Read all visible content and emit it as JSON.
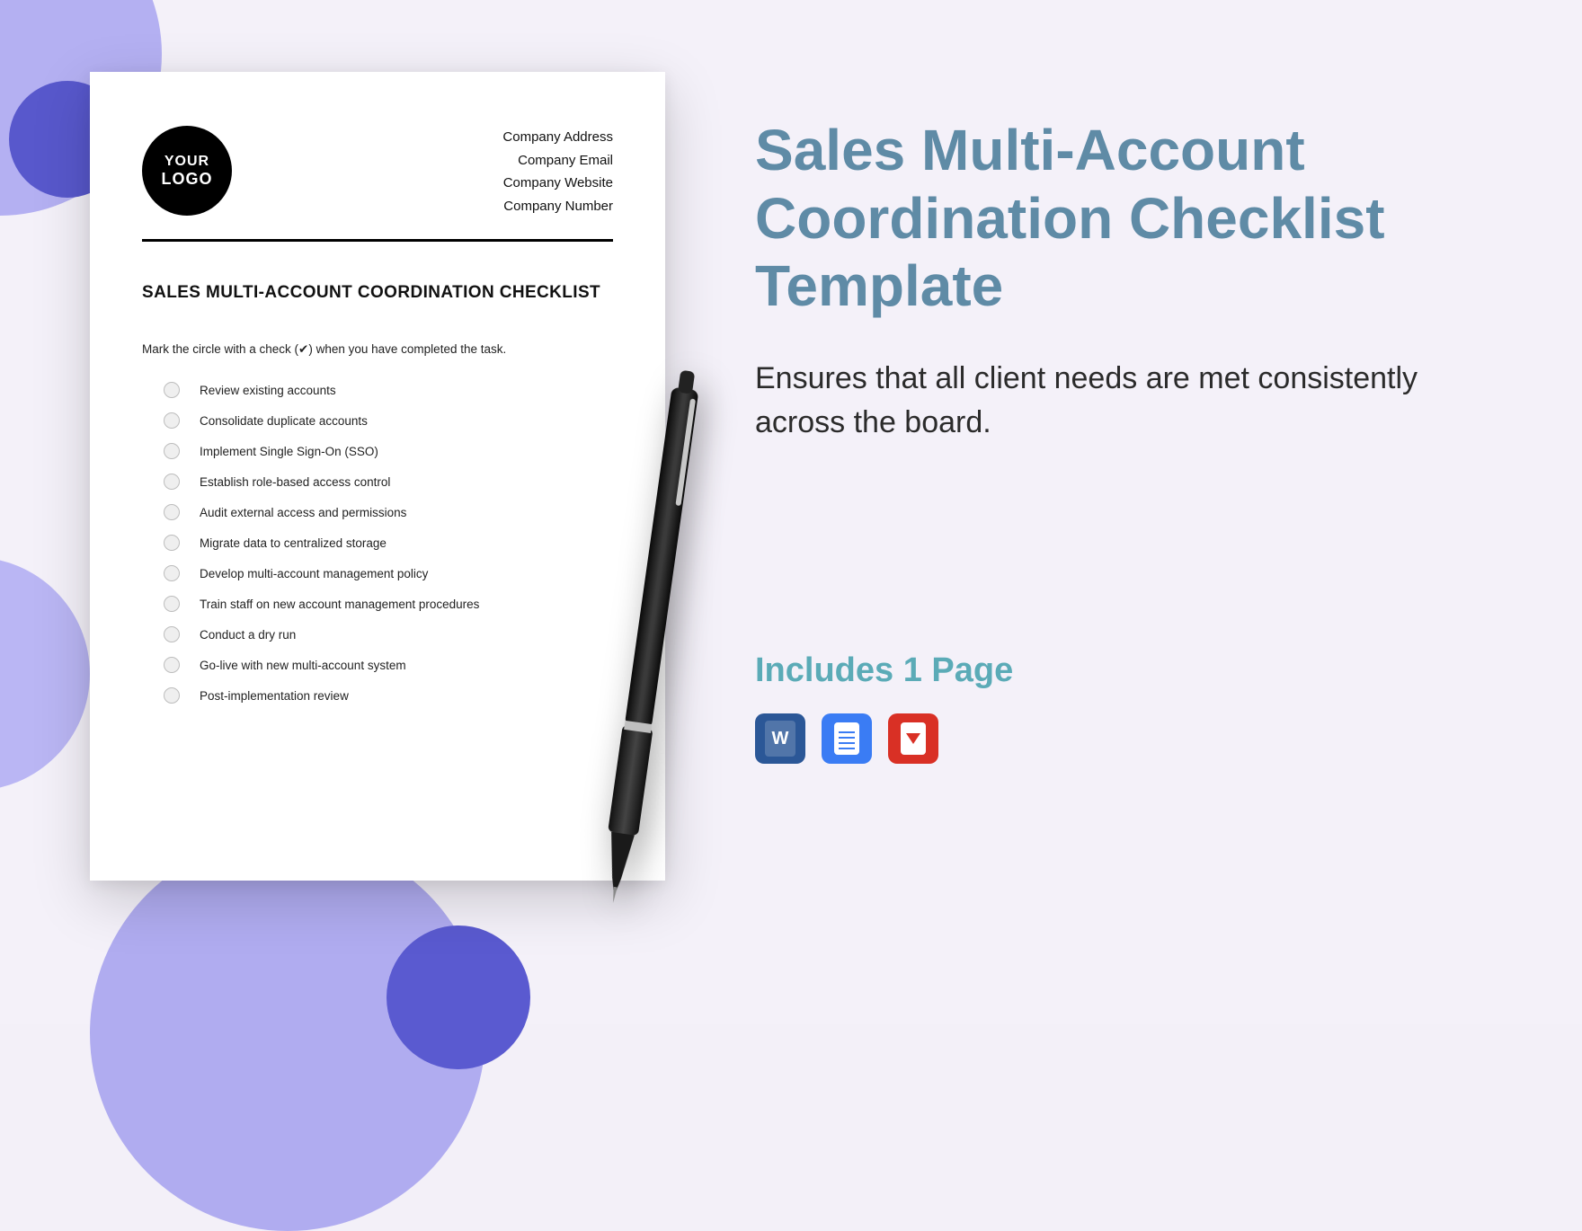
{
  "document": {
    "logo": {
      "line1": "YOUR",
      "line2": "LOGO"
    },
    "company_info": [
      "Company Address",
      "Company Email",
      "Company Website",
      "Company Number"
    ],
    "title": "SALES MULTI-ACCOUNT COORDINATION CHECKLIST",
    "instruction": "Mark the circle with a check (✔) when you have completed the task.",
    "checklist": [
      "Review existing accounts",
      "Consolidate duplicate accounts",
      "Implement Single Sign-On (SSO)",
      "Establish role-based access control",
      "Audit external access and permissions",
      "Migrate data to centralized storage",
      "Develop multi-account management policy",
      "Train staff on new account management procedures",
      "Conduct a dry run",
      "Go-live with new multi-account system",
      "Post-implementation review"
    ]
  },
  "promo": {
    "title": "Sales Multi-Account Coordination Checklist Template",
    "description": "Ensures that all client needs are met consistently across the board.",
    "includes": "Includes 1 Page",
    "formats": [
      "Word",
      "Google Docs",
      "PDF"
    ]
  },
  "colors": {
    "title": "#5f8ba6",
    "includes": "#5babb7",
    "deco_light": "#b4b0f2",
    "deco_dark": "#5858cc"
  }
}
